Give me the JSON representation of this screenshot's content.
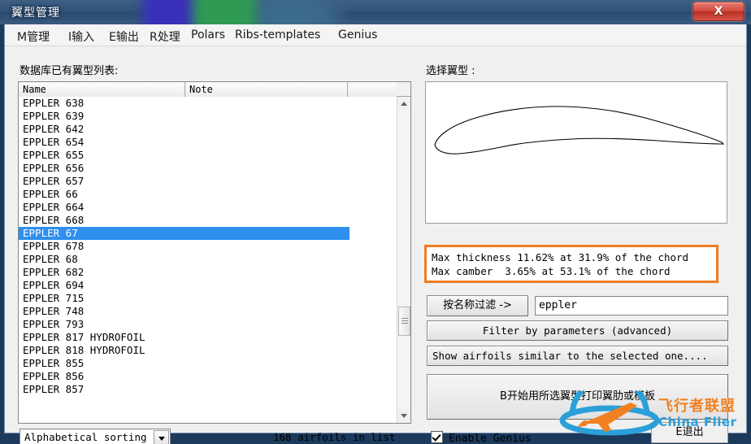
{
  "window": {
    "title": "翼型管理",
    "close_label": "X"
  },
  "menu": [
    {
      "label": "M管理"
    },
    {
      "label": "I输入"
    },
    {
      "label": "E输出"
    },
    {
      "label": "R处理"
    },
    {
      "label": "Polars"
    },
    {
      "label": "Ribs-templates"
    },
    {
      "label": "Genius"
    }
  ],
  "left_panel": {
    "list_label": "数据库已有翼型列表:",
    "columns": [
      "Name",
      "Note",
      ""
    ],
    "rows": [
      "EPPLER 638",
      "EPPLER 639",
      "EPPLER 642",
      "EPPLER 654",
      "EPPLER 655",
      "EPPLER 656",
      "EPPLER 657",
      "EPPLER 66",
      "EPPLER 664",
      "EPPLER 668",
      "EPPLER 67",
      "EPPLER 678",
      "EPPLER 68",
      "EPPLER 682",
      "EPPLER 694",
      "EPPLER 715",
      "EPPLER 748",
      "EPPLER 793",
      "EPPLER 817 HYDROFOIL",
      "EPPLER 818 HYDROFOIL",
      "EPPLER 855",
      "EPPLER 856",
      "EPPLER 857"
    ],
    "selected_index": 10,
    "sort_value": "Alphabetical sorting",
    "count_text": "168 airfoils in list"
  },
  "right_panel": {
    "select_label": "选择翼型 :",
    "info": {
      "thickness_line": "Max thickness 11.62% at 31.9% of the chord",
      "camber_line": "Max camber  3.65% at 53.1% of the chord",
      "border_color": "#f07c22"
    },
    "filter_button": "按名称过滤 ->",
    "filter_value": "eppler",
    "filter_placeholder": "",
    "advanced_button": "Filter by parameters (advanced)",
    "similar_button": "Show airfoils similar to the selected one....",
    "print_button": "B开始用所选翼型打印翼肋或模板",
    "exit_button": "E退出",
    "genius_checkbox": "Enable Genius",
    "genius_checked": true
  },
  "watermark": {
    "cn": "飞行者联盟",
    "en": "China Flier"
  },
  "colors": {
    "selection_blue": "#2f8fee",
    "accent_orange": "#f07c22",
    "watermark_blue": "#2b9fd8"
  }
}
